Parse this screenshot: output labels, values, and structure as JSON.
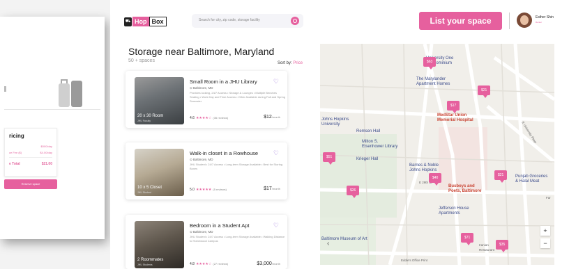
{
  "background_panel": {
    "pricing_title": "ricing",
    "rows": [
      {
        "label": "",
        "value": "$000/day"
      },
      {
        "label": "ce Fee ($)",
        "value": "$4.00/day"
      }
    ],
    "total_label": "e Total",
    "total_value": "$21.00",
    "reserve_label": "Reserve space"
  },
  "header": {
    "logo_hop": "Hop",
    "logo_box": "Box",
    "search_placeholder": "Search for city, zip code, storage facility",
    "list_button": "List your space",
    "user_name": "Esther Shin",
    "user_role": "Renter"
  },
  "results": {
    "title": "Storage near Baltimore, Maryland",
    "count": "50 + spaces",
    "sort_label": "Sort by:",
    "sort_value": "Price"
  },
  "listings": [
    {
      "title": "Small Room in a JHU Library",
      "location": "Baltimore, MD",
      "description": "Provides locking, 24/7 Access • Storage & Lounges • Multiple Benches Seating • Work Day and Time Access • Other Available during Fall and Spring Semester",
      "thumb_label": "20 x 30 Room",
      "thumb_host": "JHU Faculty",
      "rating": "4.6",
      "stars": "★★★★☆",
      "reviews": "(35 reviews)",
      "price": "$12",
      "price_unit": "/month"
    },
    {
      "title": "Walk-in closet in a Rowhouse",
      "location": "Baltimore, MD",
      "description": "JHU Student • 24/7 Access • Long-term Storage Available • Best for Storing Boxes",
      "thumb_label": "10 x 5 Closet",
      "thumb_host": "JHU Student",
      "rating": "5.0",
      "stars": "★★★★★",
      "reviews": "(5 reviews)",
      "price": "$17",
      "price_unit": "/month"
    },
    {
      "title": "Bedroom in a Student Apt",
      "location": "Baltimore, MD",
      "description": "JHU Student • 24/7 Access • Long-term Storage Available • Walking Distance to Homewood Campus",
      "thumb_label": "2 Roommates",
      "thumb_host": "JHU Students",
      "rating": "4.8",
      "stars": "★★★★☆",
      "reviews": "(27 reviews)",
      "price": "$3,000",
      "price_unit": "/month"
    }
  ],
  "map": {
    "pins": [
      "$63",
      "$21",
      "$17",
      "$51",
      "$26",
      "$40",
      "$21",
      "$71",
      "$35"
    ],
    "labels": {
      "univ_one": "University One\nCondominium",
      "marylander": "The Marylander\nApartment Homes",
      "jhu": "Johns Hopkins\nUniversity",
      "remsen": "Remsen Hall",
      "milton": "Milton S.\nEisenhower Library",
      "krieger": "Krieger Hall",
      "medstar": "MedStar Union\nMemorial Hospital",
      "barnes": "Barnes & Noble\nJohns Hopkins",
      "busboys": "Busboys and\nPoets, Baltimore",
      "punjab": "Punjab Groceries\n& Halal Meat",
      "jefferson": "Jefferson House\nApartments",
      "museum": "Baltimore Museum of Art",
      "post": "Eddie's Office Print",
      "st29": "E 29th St",
      "far": "Far",
      "univ_pkwy": "E University Pkwy",
      "restaurant": "Iranian\nRestaurant"
    },
    "zoom_in": "+",
    "zoom_out": "−",
    "back": "‹"
  }
}
